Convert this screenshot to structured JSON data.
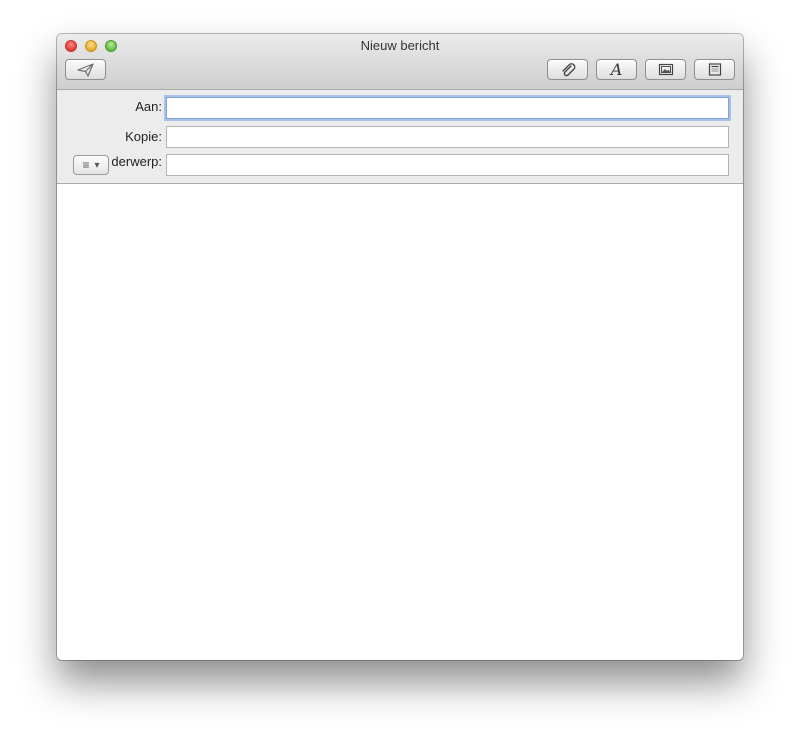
{
  "window": {
    "title": "Nieuw bericht"
  },
  "toolbar": {
    "send_icon": "paper-plane-icon",
    "attach_icon": "paperclip-icon",
    "font_icon": "font-icon",
    "font_glyph": "A",
    "photo_icon": "photo-browser-icon",
    "template_icon": "stationery-icon"
  },
  "fields": {
    "to_label": "Aan:",
    "to_value": "",
    "cc_label": "Kopie:",
    "cc_value": "",
    "subject_label": "derwerp:",
    "subject_value": ""
  },
  "priority": {
    "icon": "list-icon",
    "glyph": "≡",
    "arrow": "▾"
  },
  "body": {
    "text": ""
  }
}
